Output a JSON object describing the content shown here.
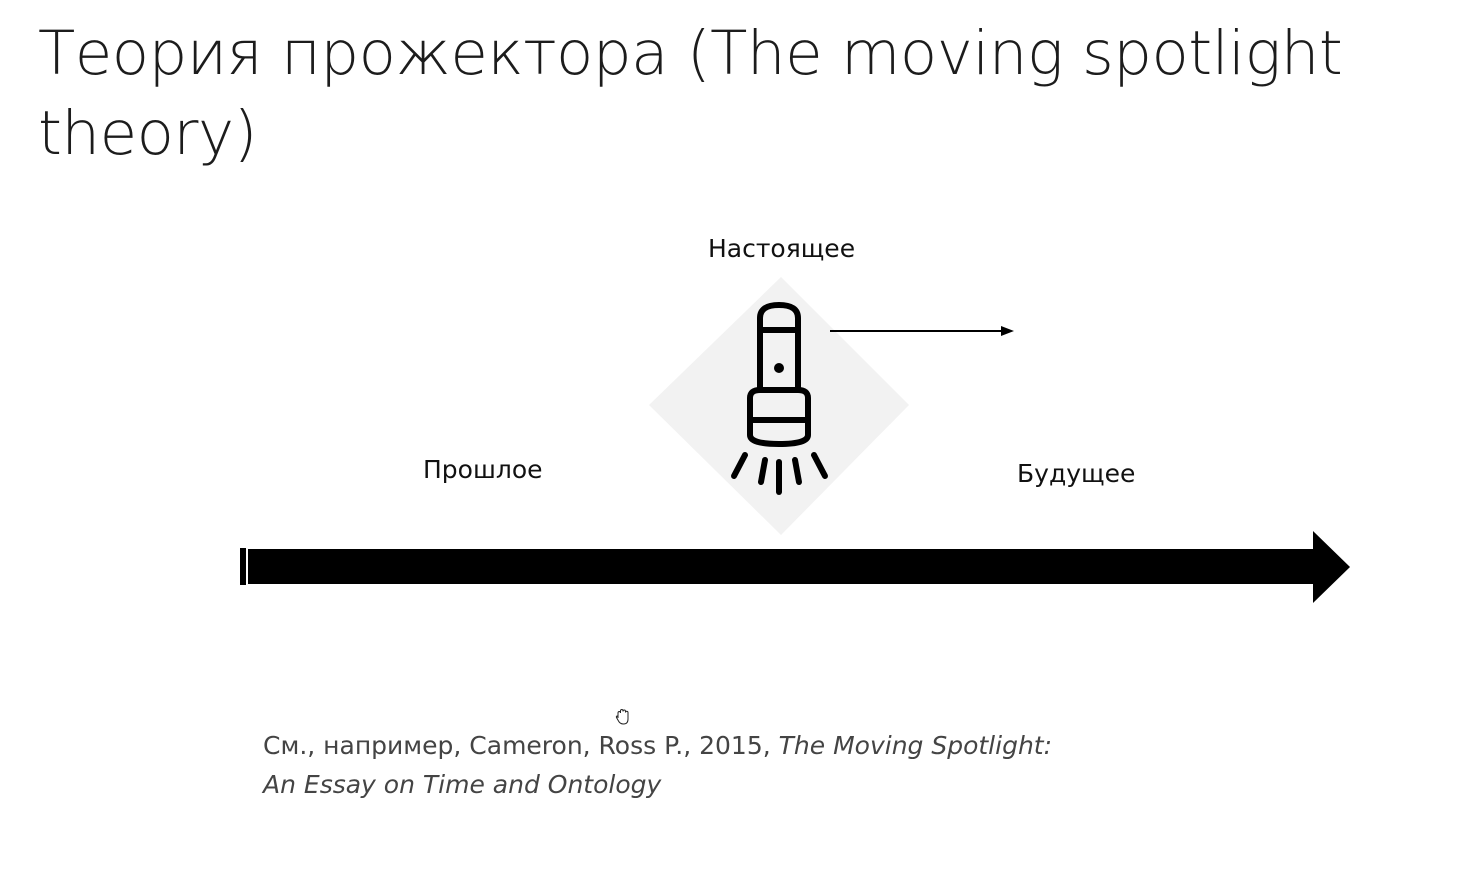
{
  "slide": {
    "title": "Теория прожектора (The moving spotlight theory)"
  },
  "diagram": {
    "label_present": "Настоящее",
    "label_past": "Прошлое",
    "label_future": "Будущее",
    "icon": "flashlight-icon",
    "colors": {
      "timeline": "#000000",
      "icon_backdrop": "#f2f2f2"
    }
  },
  "citation": {
    "prefix": "См., например, Cameron, Ross P., 2015, ",
    "title_line1": "The Moving Spotlight:",
    "title_line2": "An Essay on Time and Ontology"
  },
  "cursor": {
    "icon": "hand-cursor-icon"
  }
}
